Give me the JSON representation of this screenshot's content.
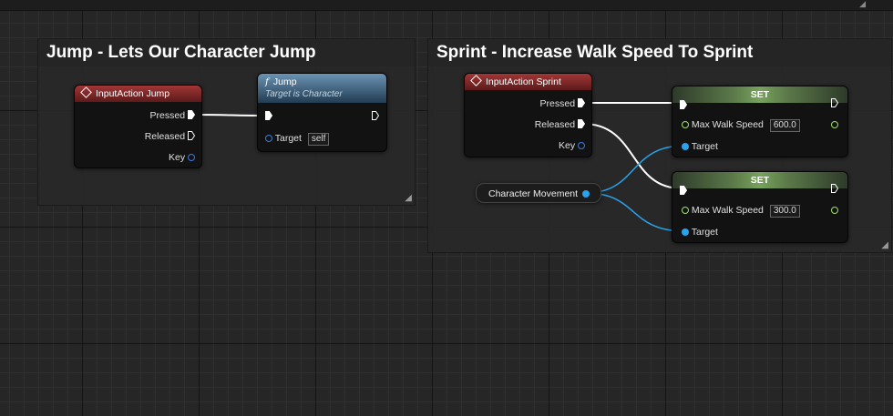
{
  "comments": {
    "jump": {
      "title": "Jump - Lets Our Character Jump"
    },
    "sprint": {
      "title": "Sprint - Increase Walk Speed To Sprint"
    }
  },
  "jump_input": {
    "title": "InputAction Jump",
    "pins": [
      "Pressed",
      "Released",
      "Key"
    ]
  },
  "jump_call": {
    "title": "Jump",
    "subtitle": "Target is Character",
    "target_label": "Target",
    "target_value": "self"
  },
  "sprint_input": {
    "title": "InputAction Sprint",
    "pins": [
      "Pressed",
      "Released",
      "Key"
    ]
  },
  "char_movement": {
    "label": "Character Movement"
  },
  "set1": {
    "title": "SET",
    "var_label": "Max Walk Speed",
    "value": "600.0",
    "target_label": "Target"
  },
  "set2": {
    "title": "SET",
    "var_label": "Max Walk Speed",
    "value": "300.0",
    "target_label": "Target"
  },
  "colors": {
    "exec_wire": "#ffffff",
    "object_wire": "#2aa2ec",
    "float_pin": "#9ee06a",
    "event_header": "#8e2e2e",
    "function_header": "#4a6e8c",
    "set_header": "#78a25c"
  }
}
